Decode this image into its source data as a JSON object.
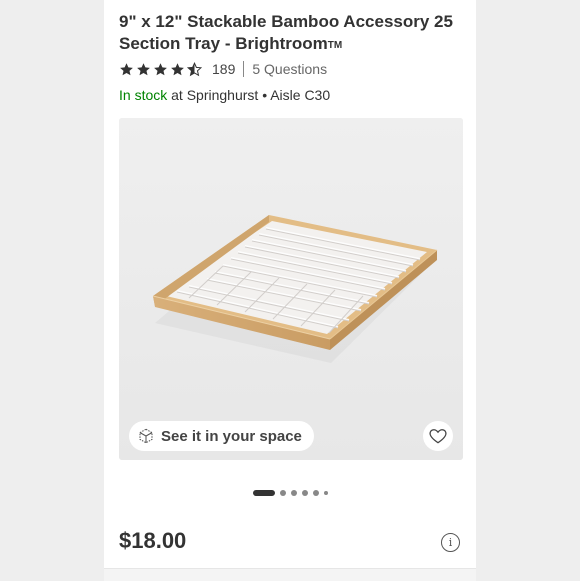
{
  "product": {
    "title": "9\" x 12\" Stackable Bamboo Accessory 25 Section Tray - Brightroom",
    "trademark": "TM"
  },
  "rating": {
    "stars": 4.5,
    "count": "189",
    "questions": "5 Questions"
  },
  "availability": {
    "status": "In stock",
    "location": "at Springhurst • Aisle C30"
  },
  "gallery": {
    "ar_label": "See it in your space",
    "slides_total": 6,
    "active_slide": 1
  },
  "price": "$18.00",
  "colors": {
    "in_stock": "#008300",
    "star": "#333333",
    "bamboo": "#dcb57f",
    "tray_insert": "#f5f3f2"
  },
  "icons": {
    "ar": "3d-cube-icon",
    "favorite": "heart-icon",
    "info": "info-icon",
    "star": "star-icon"
  }
}
